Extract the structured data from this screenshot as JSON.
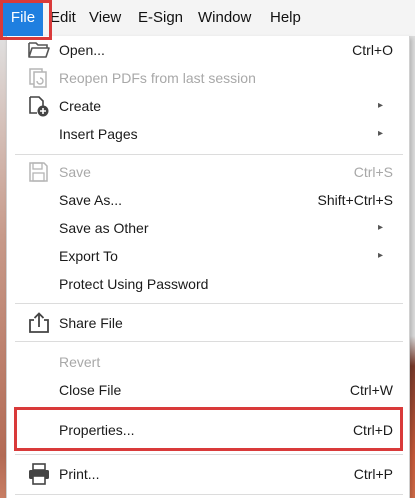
{
  "menubar": {
    "items": [
      {
        "label": "File",
        "active": true
      },
      {
        "label": "Edit"
      },
      {
        "label": "View"
      },
      {
        "label": "E-Sign"
      },
      {
        "label": "Window"
      },
      {
        "label": "Help"
      }
    ]
  },
  "menu": {
    "items": [
      {
        "label": "Open...",
        "shortcut": "Ctrl+O",
        "icon": "open-folder-icon",
        "enabled": true
      },
      {
        "label": "Reopen PDFs from last session",
        "shortcut": "",
        "icon": "reopen-icon",
        "enabled": false
      },
      {
        "label": "Create",
        "shortcut": "",
        "icon": "create-icon",
        "enabled": true,
        "submenu": true
      },
      {
        "label": "Insert Pages",
        "shortcut": "",
        "enabled": true,
        "submenu": true
      },
      {
        "label": "Save",
        "shortcut": "Ctrl+S",
        "icon": "save-icon",
        "enabled": false
      },
      {
        "label": "Save As...",
        "shortcut": "Shift+Ctrl+S",
        "enabled": true
      },
      {
        "label": "Save as Other",
        "shortcut": "",
        "enabled": true,
        "submenu": true
      },
      {
        "label": "Export To",
        "shortcut": "",
        "enabled": true,
        "submenu": true
      },
      {
        "label": "Protect Using Password",
        "shortcut": "",
        "enabled": true
      },
      {
        "label": "Share File",
        "shortcut": "",
        "icon": "share-icon",
        "enabled": true
      },
      {
        "label": "Revert",
        "shortcut": "",
        "enabled": false
      },
      {
        "label": "Close File",
        "shortcut": "Ctrl+W",
        "enabled": true
      },
      {
        "label": "Properties...",
        "shortcut": "Ctrl+D",
        "enabled": true,
        "highlighted": true
      },
      {
        "label": "Print...",
        "shortcut": "Ctrl+P",
        "icon": "print-icon",
        "enabled": true
      }
    ],
    "submenu_arrow": "▸"
  },
  "colors": {
    "menubar_active": "#1f7fe0",
    "highlight_border": "#d93a3a",
    "disabled_text": "#a8a8a8"
  }
}
